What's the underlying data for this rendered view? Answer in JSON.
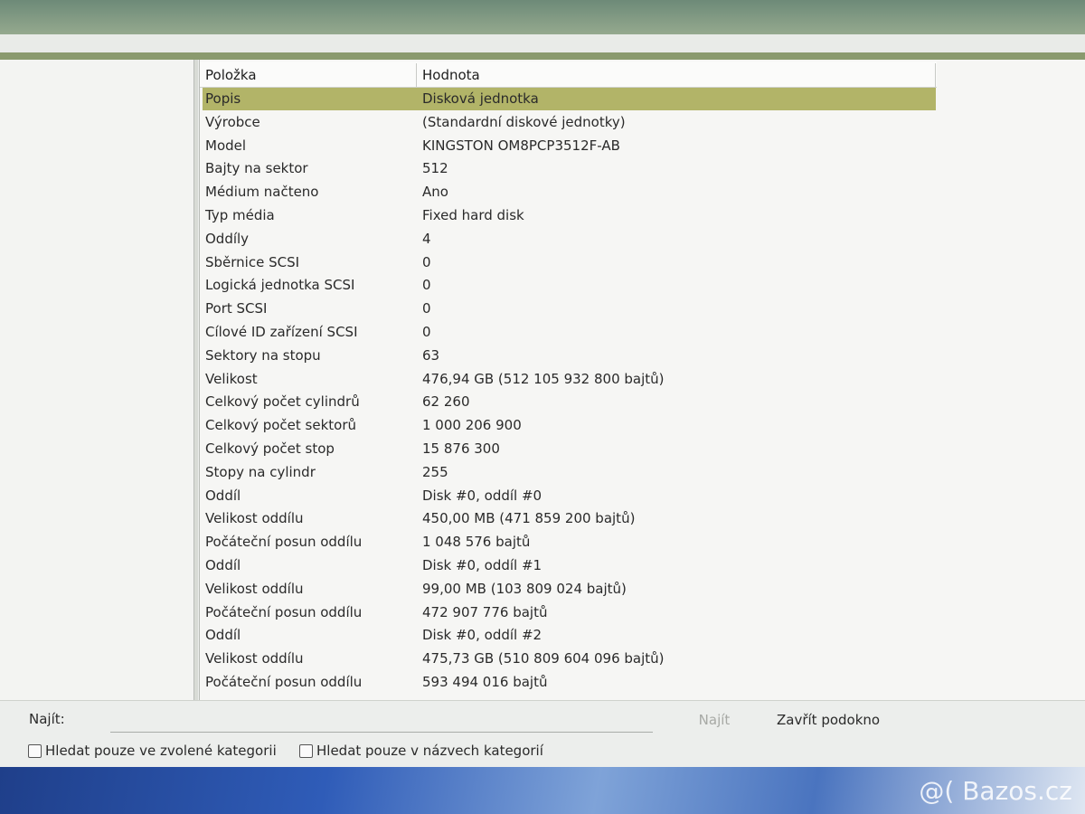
{
  "list": {
    "columns": {
      "item": "Položka",
      "value": "Hodnota"
    },
    "rows": [
      {
        "item": "Popis",
        "value": "Disková jednotka"
      },
      {
        "item": "Výrobce",
        "value": "(Standardní diskové jednotky)"
      },
      {
        "item": "Model",
        "value": "KINGSTON OM8PCP3512F-AB"
      },
      {
        "item": "Bajty na sektor",
        "value": "512"
      },
      {
        "item": "Médium načteno",
        "value": "Ano"
      },
      {
        "item": "Typ média",
        "value": "Fixed hard disk"
      },
      {
        "item": "Oddíly",
        "value": "4"
      },
      {
        "item": "Sběrnice SCSI",
        "value": "0"
      },
      {
        "item": "Logická jednotka SCSI",
        "value": "0"
      },
      {
        "item": "Port SCSI",
        "value": "0"
      },
      {
        "item": "Cílové ID zařízení SCSI",
        "value": "0"
      },
      {
        "item": "Sektory na stopu",
        "value": "63"
      },
      {
        "item": "Velikost",
        "value": "476,94 GB (512 105 932 800 bajtů)"
      },
      {
        "item": "Celkový počet cylindrů",
        "value": "62 260"
      },
      {
        "item": "Celkový počet sektorů",
        "value": "1 000 206 900"
      },
      {
        "item": "Celkový počet stop",
        "value": "15 876 300"
      },
      {
        "item": "Stopy na cylindr",
        "value": "255"
      },
      {
        "item": "Oddíl",
        "value": "Disk #0, oddíl #0"
      },
      {
        "item": "Velikost oddílu",
        "value": "450,00 MB (471 859 200 bajtů)"
      },
      {
        "item": "Počáteční posun oddílu",
        "value": "1 048 576 bajtů"
      },
      {
        "item": "Oddíl",
        "value": "Disk #0, oddíl #1"
      },
      {
        "item": "Velikost oddílu",
        "value": "99,00 MB (103 809 024 bajtů)"
      },
      {
        "item": "Počáteční posun oddílu",
        "value": "472 907 776 bajtů"
      },
      {
        "item": "Oddíl",
        "value": "Disk #0, oddíl #2"
      },
      {
        "item": "Velikost oddílu",
        "value": "475,73 GB (510 809 604 096 bajtů)"
      },
      {
        "item": "Počáteční posun oddílu",
        "value": "593 494 016 bajtů"
      }
    ],
    "selected_index": 0
  },
  "find": {
    "label": "Najít:",
    "input_value": "",
    "find_button": "Najít",
    "close_button": "Zavřít podokno",
    "checkbox_selected_category": "Hledat pouze ve zvolené kategorii",
    "checkbox_category_names": "Hledat pouze v názvech kategorií"
  },
  "watermark": "@( Bazos.cz",
  "colors": {
    "selection": "#b2b468",
    "accent_line": "#8a9a6e"
  }
}
